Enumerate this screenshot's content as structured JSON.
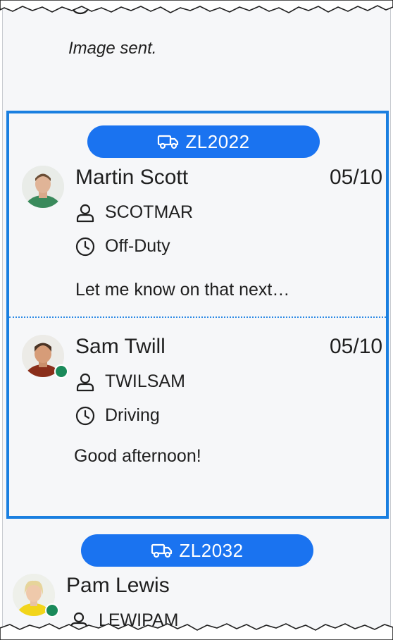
{
  "previous": {
    "message": "Image sent."
  },
  "groups": [
    {
      "truck_id": "ZL2022",
      "conversations": [
        {
          "name": "Martin Scott",
          "date": "05/10",
          "user_id": "SCOTMAR",
          "status": "Off-Duty",
          "snippet": "Let me know on that next…",
          "online": false
        },
        {
          "name": "Sam Twill",
          "date": "05/10",
          "user_id": "TWILSAM",
          "status": "Driving",
          "snippet": "Good afternoon!",
          "online": true
        }
      ]
    },
    {
      "truck_id": "ZL2032",
      "conversations": [
        {
          "name": "Pam Lewis",
          "user_id": "LEWIPAM",
          "online": true
        }
      ]
    }
  ],
  "icons": {
    "truck": "truck-icon",
    "user": "user-icon",
    "clock": "clock-icon"
  },
  "colors": {
    "accent": "#1a73f0",
    "selection_border": "#1a7fe0",
    "online": "#1a8a5a",
    "background": "#f6f7f9"
  }
}
